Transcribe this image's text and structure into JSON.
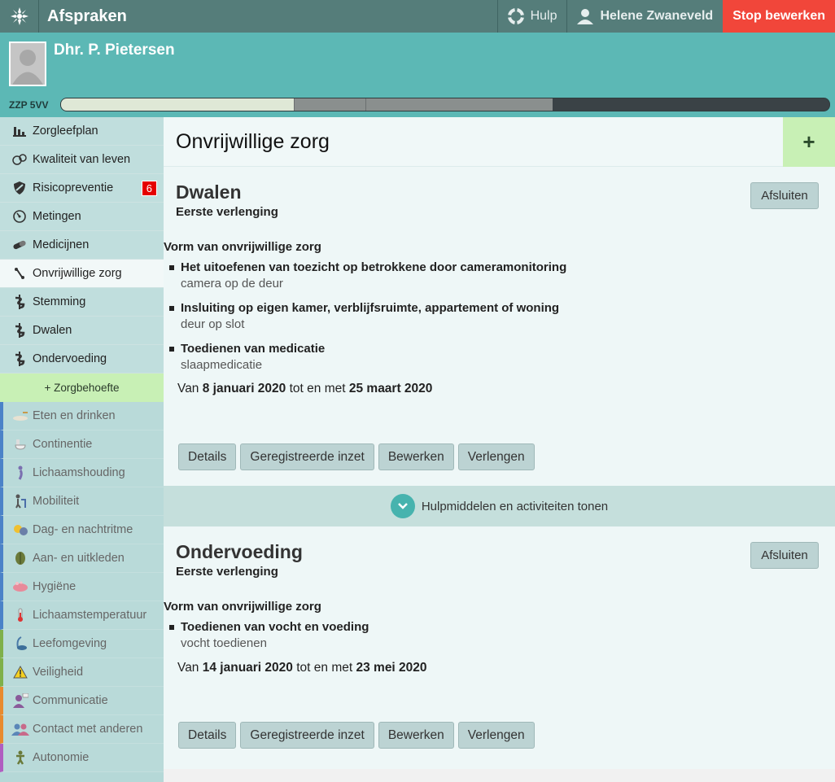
{
  "app": {
    "title": "Afspraken",
    "help_label": "Hulp",
    "user_name": "Helene Zwaneveld",
    "stop_label": "Stop bewerken"
  },
  "patient": {
    "name": "Dhr. P. Pietersen",
    "zzp_label": "ZZP 5VV"
  },
  "sidebar": {
    "items": [
      {
        "label": "Zorgleefplan",
        "icon": "bar-chart-icon"
      },
      {
        "label": "Kwaliteit van leven",
        "icon": "faces-icon"
      },
      {
        "label": "Risicopreventie",
        "icon": "shield-icon",
        "badge": "6"
      },
      {
        "label": "Metingen",
        "icon": "gauge-icon"
      },
      {
        "label": "Medicijnen",
        "icon": "pill-icon"
      },
      {
        "label": "Onvrijwillige zorg",
        "icon": "restraint-icon",
        "active": true
      },
      {
        "label": "Stemming",
        "icon": "caduceus-icon"
      },
      {
        "label": "Dwalen",
        "icon": "caduceus-icon"
      },
      {
        "label": "Ondervoeding",
        "icon": "caduceus-icon"
      }
    ],
    "add_label": "+ Zorgbehoefte",
    "needs": [
      {
        "label": "Eten en drinken",
        "color": "#4b82c8"
      },
      {
        "label": "Continentie",
        "color": "#4b82c8"
      },
      {
        "label": "Lichaamshouding",
        "color": "#4b82c8"
      },
      {
        "label": "Mobiliteit",
        "color": "#4b82c8"
      },
      {
        "label": "Dag- en nachtritme",
        "color": "#4b82c8"
      },
      {
        "label": "Aan- en uitkleden",
        "color": "#4b82c8"
      },
      {
        "label": "Hygiëne",
        "color": "#4b82c8"
      },
      {
        "label": "Lichaamstemperatuur",
        "color": "#4b82c8"
      },
      {
        "label": "Leefomgeving",
        "color": "#7fb04a"
      },
      {
        "label": "Veiligheid",
        "color": "#7fb04a"
      },
      {
        "label": "Communicatie",
        "color": "#e88a2e"
      },
      {
        "label": "Contact met anderen",
        "color": "#e88a2e"
      },
      {
        "label": "Autonomie",
        "color": "#b05ec0"
      }
    ]
  },
  "main": {
    "title": "Onvrijwillige zorg",
    "add_symbol": "+",
    "section_label": "Vorm van onvrijwillige zorg",
    "close_label": "Afsluiten",
    "period_prefix": "Van",
    "period_mid": "tot en met",
    "buttons": {
      "details": "Details",
      "registered": "Geregistreerde inzet",
      "edit": "Bewerken",
      "extend": "Verlengen"
    },
    "toggle_label": "Hulpmiddelen en activiteiten tonen",
    "cards": [
      {
        "title": "Dwalen",
        "subtitle": "Eerste verlenging",
        "items": [
          {
            "title": "Het uitoefenen van toezicht op betrokkene door cameramonitoring",
            "desc": "camera op de deur"
          },
          {
            "title": "Insluiting op eigen kamer, verblijfsruimte, appartement of woning",
            "desc": "deur op slot"
          },
          {
            "title": "Toedienen van medicatie",
            "desc": "slaapmedicatie"
          }
        ],
        "start": "8 januari 2020",
        "end": "25 maart 2020"
      },
      {
        "title": "Ondervoeding",
        "subtitle": "Eerste verlenging",
        "items": [
          {
            "title": "Toedienen van vocht en voeding",
            "desc": "vocht toedienen"
          }
        ],
        "start": "14 januari 2020",
        "end": "23 mei 2020"
      }
    ]
  }
}
